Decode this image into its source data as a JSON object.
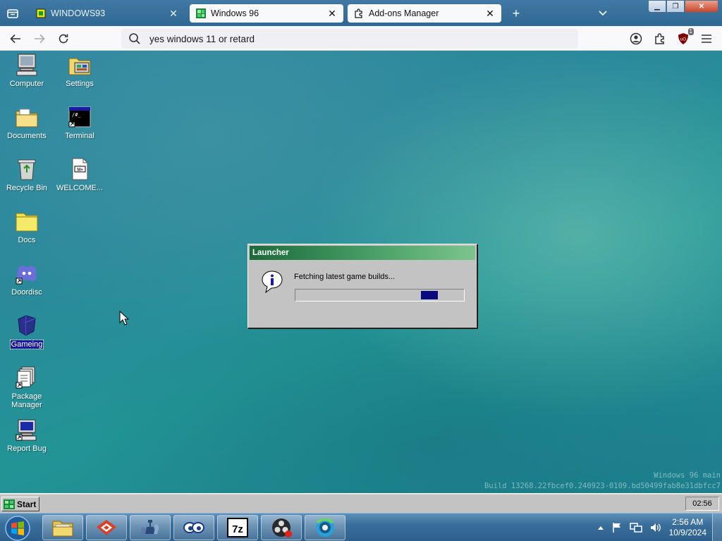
{
  "browser": {
    "tabs": [
      {
        "label": "WINDOWS93",
        "active": false
      },
      {
        "label": "Windows 96",
        "active": true
      },
      {
        "label": "Add-ons Manager",
        "active": false
      }
    ],
    "url": "yes windows 11 or retard",
    "ublock_badge": "1"
  },
  "desktop": {
    "icons": [
      {
        "label": "Computer",
        "icon": "computer-icon"
      },
      {
        "label": "Settings",
        "icon": "settings-icon"
      },
      {
        "label": "Documents",
        "icon": "documents-folder-icon"
      },
      {
        "label": "Terminal",
        "icon": "terminal-icon"
      },
      {
        "label": "Recycle Bin",
        "icon": "recycle-bin-icon"
      },
      {
        "label": "WELCOME...",
        "icon": "markdown-file-icon"
      },
      {
        "label": "Docs",
        "icon": "folder-icon"
      },
      {
        "label": "Doordisc",
        "icon": "discord-icon"
      },
      {
        "label": "Gameing",
        "icon": "game-icon"
      },
      {
        "label": "Package Manager",
        "icon": "package-manager-icon"
      },
      {
        "label": "Report Bug",
        "icon": "report-bug-icon"
      }
    ],
    "watermark_line1": "Windows 96 main",
    "watermark_line2": "Build 13268.22fbcef0.240923-0109.bd50499fab8e31dbfcc7"
  },
  "launcher": {
    "title": "Launcher",
    "message": "Fetching latest game builds...",
    "progress_chunk_start": 0.75,
    "progress_chunk_width": 0.1
  },
  "w96_taskbar": {
    "start_label": "Start",
    "clock": "02:56"
  },
  "host_taskbar": {
    "time": "2:56 AM",
    "date": "10/9/2024",
    "pinned": [
      "file-explorer-icon",
      "gitkraken-icon",
      "chess-icon",
      "eyes-icon",
      "7zip-icon",
      "obs-icon",
      "browser-icon"
    ]
  }
}
